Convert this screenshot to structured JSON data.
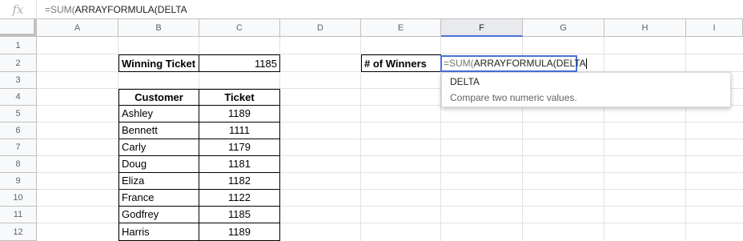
{
  "formula_bar": {
    "fx_label": "fx",
    "formula_prefix": "=SUM(",
    "formula_rest": "ARRAYFORMULA(DELTA"
  },
  "columns": [
    "A",
    "B",
    "C",
    "D",
    "E",
    "F",
    "G",
    "H",
    "I"
  ],
  "selected_column": "F",
  "rows": [
    "1",
    "2",
    "3",
    "4",
    "5",
    "6",
    "7",
    "8",
    "9",
    "10",
    "11",
    "12"
  ],
  "winning": {
    "label": "Winning Ticket",
    "value": "1185"
  },
  "winners": {
    "label": "# of Winners",
    "editor_prefix": "=SUM(",
    "editor_rest": "ARRAYFORMULA(DELTA"
  },
  "table": {
    "headers": [
      "Customer",
      "Ticket"
    ],
    "rows": [
      [
        "Ashley",
        "1189"
      ],
      [
        "Bennett",
        "1111"
      ],
      [
        "Carly",
        "1179"
      ],
      [
        "Doug",
        "1181"
      ],
      [
        "Eliza",
        "1182"
      ],
      [
        "France",
        "1122"
      ],
      [
        "Godfrey",
        "1185"
      ],
      [
        "Harris",
        "1189"
      ]
    ]
  },
  "autocomplete": {
    "function_name": "DELTA",
    "description": "Compare two numeric values."
  },
  "colors": {
    "selection": "#4a72d8",
    "header_bg": "#f8f9fa",
    "grid": "#e2e2e2"
  }
}
